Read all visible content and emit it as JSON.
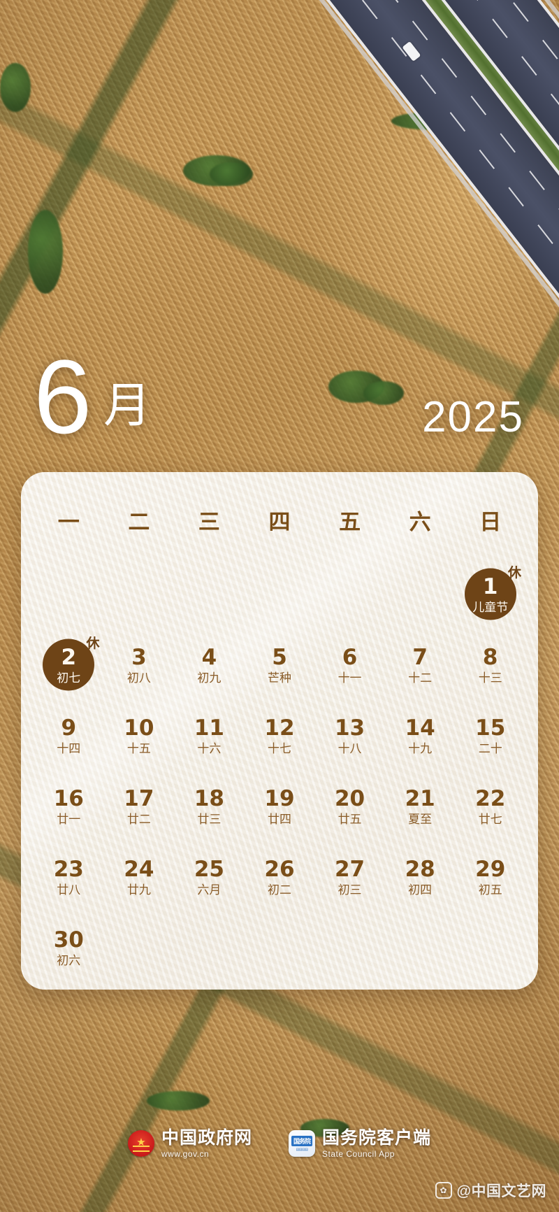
{
  "header": {
    "month_number": "6",
    "month_suffix": "月",
    "year": "2025"
  },
  "colors": {
    "accent_brown": "#6e4417",
    "text_brown": "#7a4e18",
    "lunar_brown": "#8a5c28",
    "card_bg": "#f5f1e8"
  },
  "calendar": {
    "weekdays": [
      "一",
      "二",
      "三",
      "四",
      "五",
      "六",
      "日"
    ],
    "leading_blanks": 6,
    "days": [
      {
        "num": "1",
        "lunar": "儿童节",
        "selected": true,
        "rest": "休"
      },
      {
        "num": "2",
        "lunar": "初七",
        "selected": true,
        "rest": "休"
      },
      {
        "num": "3",
        "lunar": "初八",
        "selected": false,
        "rest": ""
      },
      {
        "num": "4",
        "lunar": "初九",
        "selected": false,
        "rest": ""
      },
      {
        "num": "5",
        "lunar": "芒种",
        "selected": false,
        "rest": ""
      },
      {
        "num": "6",
        "lunar": "十一",
        "selected": false,
        "rest": ""
      },
      {
        "num": "7",
        "lunar": "十二",
        "selected": false,
        "rest": ""
      },
      {
        "num": "8",
        "lunar": "十三",
        "selected": false,
        "rest": ""
      },
      {
        "num": "9",
        "lunar": "十四",
        "selected": false,
        "rest": ""
      },
      {
        "num": "10",
        "lunar": "十五",
        "selected": false,
        "rest": ""
      },
      {
        "num": "11",
        "lunar": "十六",
        "selected": false,
        "rest": ""
      },
      {
        "num": "12",
        "lunar": "十七",
        "selected": false,
        "rest": ""
      },
      {
        "num": "13",
        "lunar": "十八",
        "selected": false,
        "rest": ""
      },
      {
        "num": "14",
        "lunar": "十九",
        "selected": false,
        "rest": ""
      },
      {
        "num": "15",
        "lunar": "二十",
        "selected": false,
        "rest": ""
      },
      {
        "num": "16",
        "lunar": "廿一",
        "selected": false,
        "rest": ""
      },
      {
        "num": "17",
        "lunar": "廿二",
        "selected": false,
        "rest": ""
      },
      {
        "num": "18",
        "lunar": "廿三",
        "selected": false,
        "rest": ""
      },
      {
        "num": "19",
        "lunar": "廿四",
        "selected": false,
        "rest": ""
      },
      {
        "num": "20",
        "lunar": "廿五",
        "selected": false,
        "rest": ""
      },
      {
        "num": "21",
        "lunar": "夏至",
        "selected": false,
        "rest": ""
      },
      {
        "num": "22",
        "lunar": "廿七",
        "selected": false,
        "rest": ""
      },
      {
        "num": "23",
        "lunar": "廿八",
        "selected": false,
        "rest": ""
      },
      {
        "num": "24",
        "lunar": "廿九",
        "selected": false,
        "rest": ""
      },
      {
        "num": "25",
        "lunar": "六月",
        "selected": false,
        "rest": ""
      },
      {
        "num": "26",
        "lunar": "初二",
        "selected": false,
        "rest": ""
      },
      {
        "num": "27",
        "lunar": "初三",
        "selected": false,
        "rest": ""
      },
      {
        "num": "28",
        "lunar": "初四",
        "selected": false,
        "rest": ""
      },
      {
        "num": "29",
        "lunar": "初五",
        "selected": false,
        "rest": ""
      },
      {
        "num": "30",
        "lunar": "初六",
        "selected": false,
        "rest": ""
      }
    ]
  },
  "footer": {
    "gov_site": {
      "name": "中国政府网",
      "url": "www.gov.cn",
      "icon": "national-emblem-icon"
    },
    "state_council_app": {
      "name": "国务院客户端",
      "subtitle": "State Council App",
      "icon": "state-council-app-icon",
      "badge": "国务院"
    }
  },
  "watermark": {
    "icon": "weibo-icon",
    "text": "@中国文艺网"
  }
}
